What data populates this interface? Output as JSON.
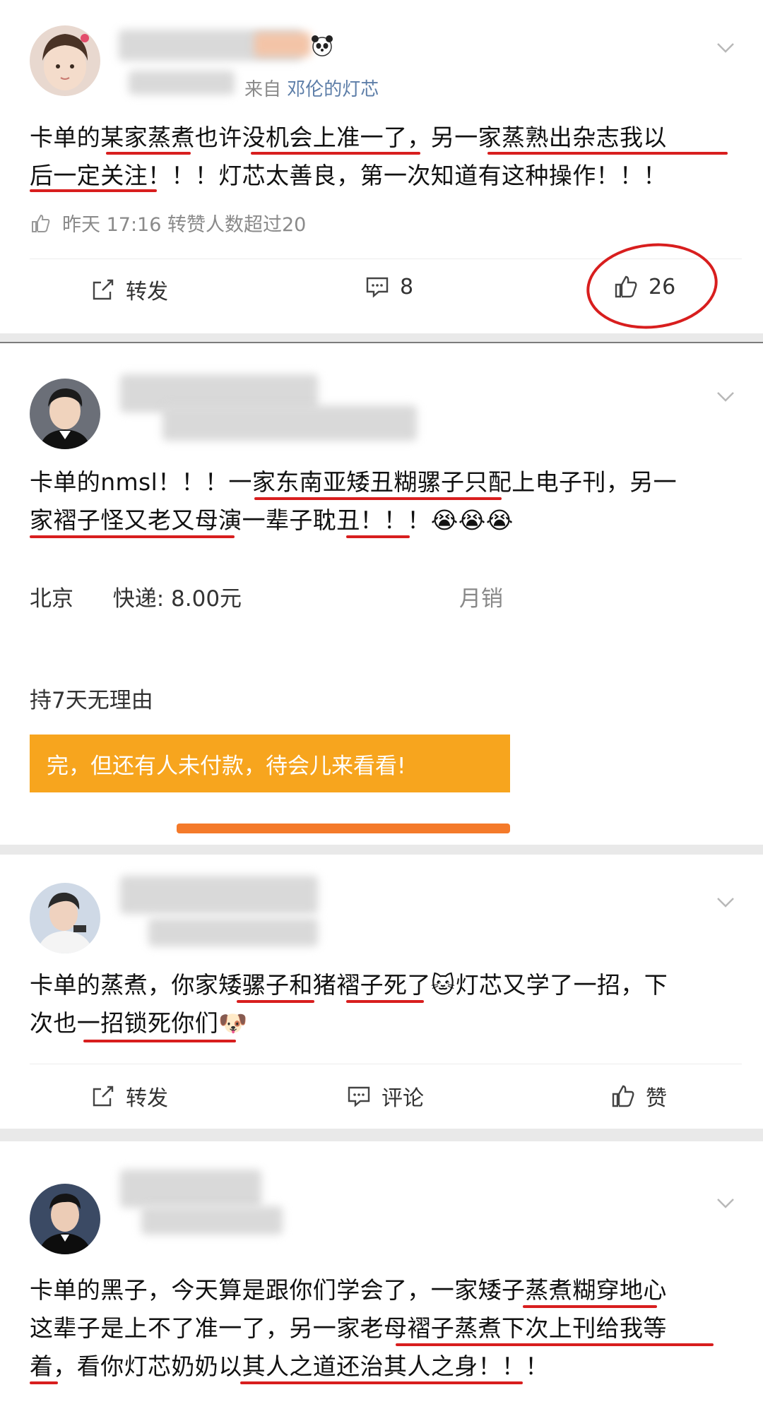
{
  "posts": [
    {
      "source_prefix": "来自",
      "source_link": "邓伦的灯芯",
      "lines": [
        "卡单的某家蒸煮也许没机会上准一了，另一家蒸熟出杂志我以",
        "后一定关注！！！灯芯太善良，第一次知道有这种操作！！！"
      ],
      "meta": "昨天 17:16 转赞人数超过20",
      "repost_label": "转发",
      "comment_count": "8",
      "like_count": "26"
    },
    {
      "lines": [
        "卡单的nmsl！！！一家东南亚矮丑糊骡子只配上电子刊，另一",
        "家褶子怪又老又母演一辈子耽丑！！！😭😭😭"
      ],
      "ad": {
        "city": "北京",
        "shipping": "快递: 8.00元",
        "sales": "月销",
        "return_policy": "持7天无理由",
        "banner": "完，但还有人未付款，待会儿来看看!"
      }
    },
    {
      "lines": [
        "卡单的蒸煮，你家矮骡子和猪褶子死了🐱灯芯又学了一招，下",
        "次也一招锁死你们🐶"
      ],
      "repost_label": "转发",
      "comment_label": "评论",
      "like_label": "赞"
    },
    {
      "lines": [
        "卡单的黑子，今天算是跟你们学会了，一家矮子蒸煮糊穿地心",
        "这辈子是上不了准一了，另一家老母褶子蒸煮下次上刊给我等",
        "着，看你灯芯奶奶以其人之道还治其人之身！！！"
      ]
    }
  ],
  "icons": {
    "panda": "panda-emoji-icon",
    "chevron": "chevron-down-icon",
    "like": "thumbs-up-icon",
    "repost": "repost-icon",
    "comment": "comment-icon"
  },
  "colors": {
    "link": "#5d7ea8",
    "annotation": "#d81e1e",
    "banner": "#f7a51e"
  }
}
